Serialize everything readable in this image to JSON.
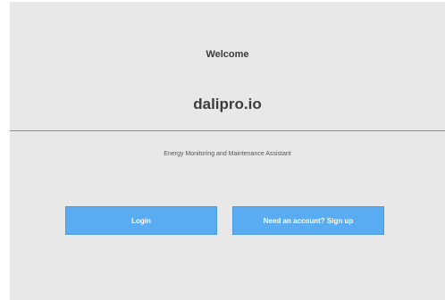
{
  "header": {
    "welcome": "Welcome",
    "brand": "dalipro.io"
  },
  "main": {
    "tagline": "Energy Monitoring and Maintenance Assistant",
    "login_label": "Login",
    "signup_label": "Need an account? Sign up"
  },
  "colors": {
    "background": "#e8e8e8",
    "button": "#5aacf2",
    "divider": "#8a8a8a"
  }
}
